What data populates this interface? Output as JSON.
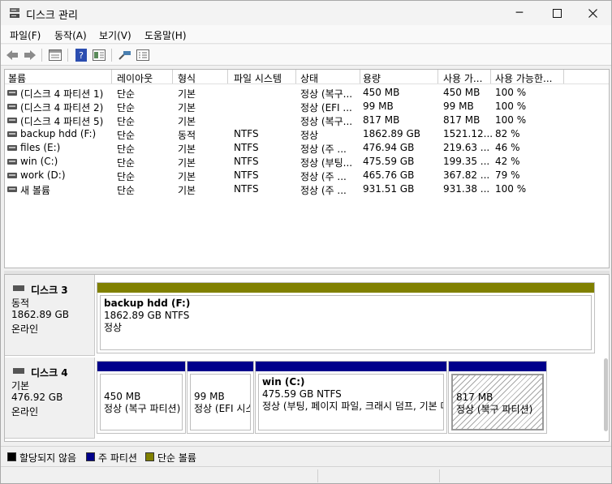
{
  "window": {
    "title": "디스크 관리"
  },
  "menu": [
    "파일(F)",
    "동작(A)",
    "보기(V)",
    "도움말(H)"
  ],
  "toolbar_icons": [
    "back-arrow-icon",
    "forward-arrow-icon",
    "properties-icon",
    "help-icon",
    "view-icon",
    "connect-icon",
    "details-icon"
  ],
  "table": {
    "columns": [
      "볼륨",
      "레이아웃",
      "형식",
      "파일 시스템",
      "상태",
      "용량",
      "사용 가...",
      "사용 가능한..."
    ],
    "rows": [
      [
        "(디스크 4 파티션 1)",
        "단순",
        "기본",
        "",
        "정상 (복구...",
        "450 MB",
        "450 MB",
        "100 %"
      ],
      [
        "(디스크 4 파티션 2)",
        "단순",
        "기본",
        "",
        "정상 (EFI ...",
        "99 MB",
        "99 MB",
        "100 %"
      ],
      [
        "(디스크 4 파티션 5)",
        "단순",
        "기본",
        "",
        "정상 (복구...",
        "817 MB",
        "817 MB",
        "100 %"
      ],
      [
        "backup hdd (F:)",
        "단순",
        "동적",
        "NTFS",
        "정상",
        "1862.89 GB",
        "1521.12...",
        "82 %"
      ],
      [
        "files (E:)",
        "단순",
        "기본",
        "NTFS",
        "정상 (주 ...",
        "476.94 GB",
        "219.63 ...",
        "46 %"
      ],
      [
        "win (C:)",
        "단순",
        "기본",
        "NTFS",
        "정상 (부팅...",
        "475.59 GB",
        "199.35 ...",
        "42 %"
      ],
      [
        "work (D:)",
        "단순",
        "기본",
        "NTFS",
        "정상 (주 ...",
        "465.76 GB",
        "367.82 ...",
        "79 %"
      ],
      [
        "새 볼륨",
        "단순",
        "기본",
        "NTFS",
        "정상 (주 ...",
        "931.51 GB",
        "931.38 ...",
        "100 %"
      ]
    ]
  },
  "disks": [
    {
      "name": "디스크 3",
      "type": "동적",
      "size": "1862.89 GB",
      "status": "온라인",
      "partitions": [
        {
          "name": "backup hdd  (F:)",
          "line1": "1862.89 GB NTFS",
          "line2": "정상",
          "bar": "#808000"
        }
      ]
    },
    {
      "name": "디스크 4",
      "type": "기본",
      "size": "476.92 GB",
      "status": "온라인",
      "partitions": [
        {
          "name": "",
          "line1": "450 MB",
          "line2": "정상 (복구 파티션)",
          "bar": "#00008b"
        },
        {
          "name": "",
          "line1": "99 MB",
          "line2": "정상 (EFI 시스템 파티션)",
          "bar": "#00008b"
        },
        {
          "name": "win  (C:)",
          "line1": "475.59 GB NTFS",
          "line2": "정상 (부팅, 페이지 파일, 크래시 덤프, 기본 데이터 파티션)",
          "bar": "#00008b"
        },
        {
          "name": "",
          "line1": "817 MB",
          "line2": "정상 (복구 파티션)",
          "bar": "#00008b",
          "selected": true
        }
      ]
    }
  ],
  "legend": [
    {
      "label": "할당되지 않음",
      "color": "#000000"
    },
    {
      "label": "주 파티션",
      "color": "#00008b"
    },
    {
      "label": "단순 볼륨",
      "color": "#808000"
    }
  ]
}
